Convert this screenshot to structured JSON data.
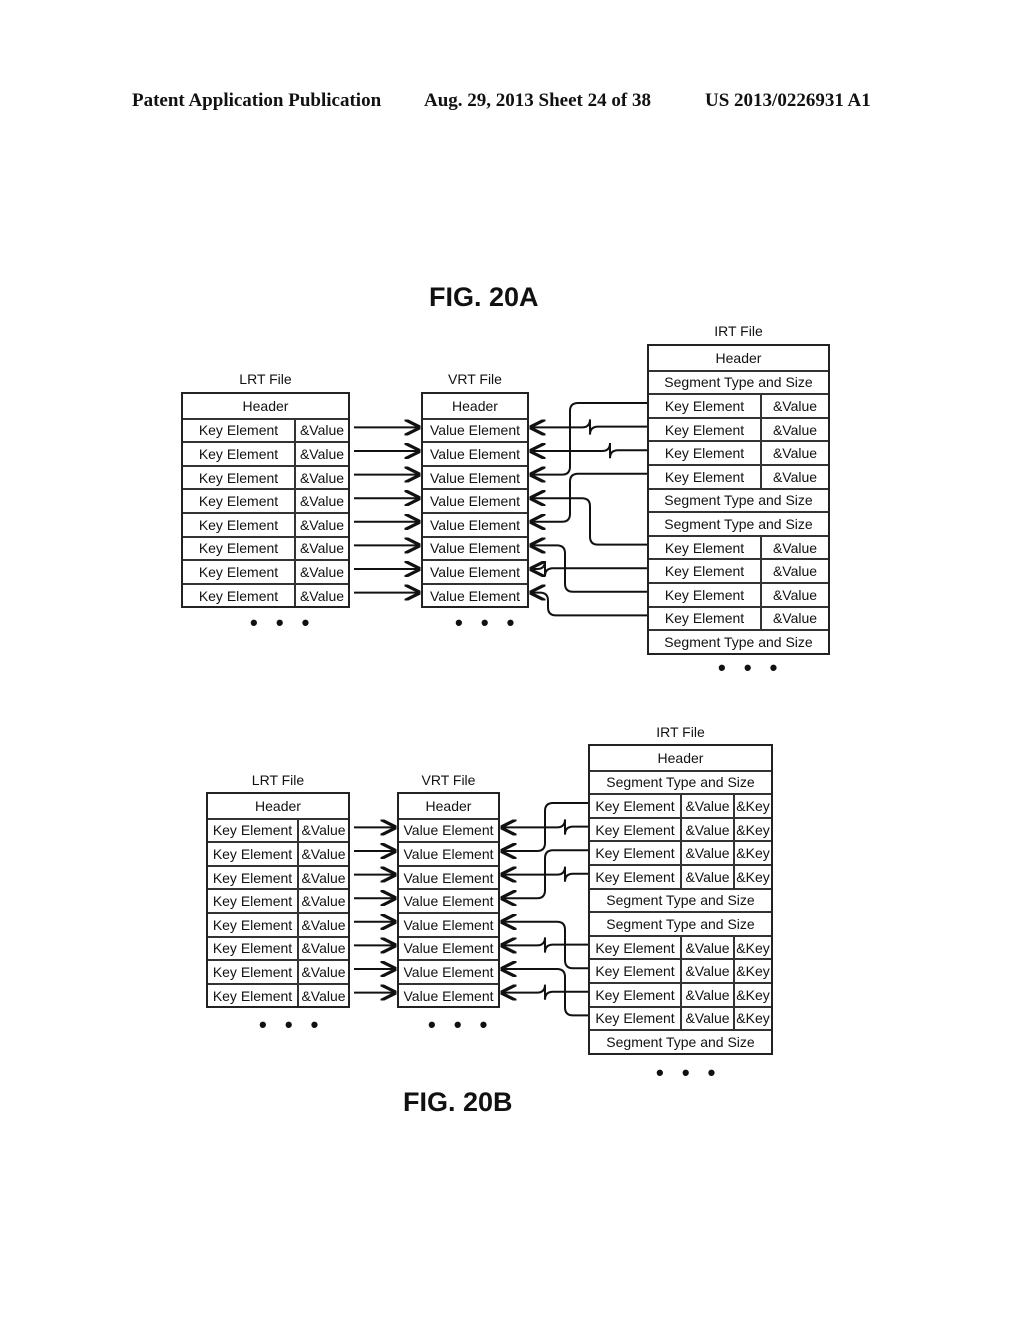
{
  "page_header": {
    "left": "Patent Application Publication",
    "middle": "Aug. 29, 2013  Sheet 24 of 38",
    "right": "US 2013/0226931 A1"
  },
  "fig_a": {
    "title": "FIG. 20A",
    "lrt": {
      "label": "LRT File",
      "header": "Header",
      "rows": [
        [
          "Key Element",
          "&Value"
        ],
        [
          "Key Element",
          "&Value"
        ],
        [
          "Key Element",
          "&Value"
        ],
        [
          "Key Element",
          "&Value"
        ],
        [
          "Key Element",
          "&Value"
        ],
        [
          "Key Element",
          "&Value"
        ],
        [
          "Key Element",
          "&Value"
        ],
        [
          "Key Element",
          "&Value"
        ]
      ],
      "ellipsis": "• • •"
    },
    "vrt": {
      "label": "VRT File",
      "header": "Header",
      "rows": [
        "Value Element",
        "Value Element",
        "Value Element",
        "Value Element",
        "Value Element",
        "Value Element",
        "Value Element",
        "Value Element"
      ],
      "ellipsis": "• • •"
    },
    "irt": {
      "label": "IRT File",
      "rows": [
        {
          "type": "full",
          "text": "Header"
        },
        {
          "type": "full",
          "text": "Segment Type and Size"
        },
        {
          "type": "kv",
          "cells": [
            "Key Element",
            "&Value"
          ]
        },
        {
          "type": "kv",
          "cells": [
            "Key Element",
            "&Value"
          ]
        },
        {
          "type": "kv",
          "cells": [
            "Key Element",
            "&Value"
          ]
        },
        {
          "type": "kv",
          "cells": [
            "Key Element",
            "&Value"
          ]
        },
        {
          "type": "full",
          "text": "Segment Type and Size"
        },
        {
          "type": "full",
          "text": "Segment Type and Size"
        },
        {
          "type": "kv",
          "cells": [
            "Key Element",
            "&Value"
          ]
        },
        {
          "type": "kv",
          "cells": [
            "Key Element",
            "&Value"
          ]
        },
        {
          "type": "kv",
          "cells": [
            "Key Element",
            "&Value"
          ]
        },
        {
          "type": "kv",
          "cells": [
            "Key Element",
            "&Value"
          ]
        },
        {
          "type": "full",
          "text": "Segment Type and Size"
        }
      ],
      "ellipsis": "• • •"
    },
    "irt_to_vrt_links": [
      [
        2,
        2
      ],
      [
        3,
        0
      ],
      [
        4,
        1
      ],
      [
        5,
        4
      ],
      [
        8,
        3
      ],
      [
        9,
        6
      ],
      [
        10,
        5
      ],
      [
        11,
        7
      ]
    ]
  },
  "fig_b": {
    "title": "FIG. 20B",
    "lrt": {
      "label": "LRT File",
      "header": "Header",
      "rows": [
        [
          "Key Element",
          "&Value"
        ],
        [
          "Key Element",
          "&Value"
        ],
        [
          "Key Element",
          "&Value"
        ],
        [
          "Key Element",
          "&Value"
        ],
        [
          "Key Element",
          "&Value"
        ],
        [
          "Key Element",
          "&Value"
        ],
        [
          "Key Element",
          "&Value"
        ],
        [
          "Key Element",
          "&Value"
        ]
      ],
      "ellipsis": "• • •"
    },
    "vrt": {
      "label": "VRT File",
      "header": "Header",
      "rows": [
        "Value Element",
        "Value Element",
        "Value Element",
        "Value Element",
        "Value Element",
        "Value Element",
        "Value Element",
        "Value Element"
      ],
      "ellipsis": "• • •"
    },
    "irt": {
      "label": "IRT File",
      "rows": [
        {
          "type": "full",
          "text": "Header"
        },
        {
          "type": "full",
          "text": "Segment Type and Size"
        },
        {
          "type": "kvk",
          "cells": [
            "Key Element",
            "&Value",
            "&Key"
          ]
        },
        {
          "type": "kvk",
          "cells": [
            "Key Element",
            "&Value",
            "&Key"
          ]
        },
        {
          "type": "kvk",
          "cells": [
            "Key Element",
            "&Value",
            "&Key"
          ]
        },
        {
          "type": "kvk",
          "cells": [
            "Key Element",
            "&Value",
            "&Key"
          ]
        },
        {
          "type": "full",
          "text": "Segment Type and Size"
        },
        {
          "type": "full",
          "text": "Segment Type and Size"
        },
        {
          "type": "kvk",
          "cells": [
            "Key Element",
            "&Value",
            "&Key"
          ]
        },
        {
          "type": "kvk",
          "cells": [
            "Key Element",
            "&Value",
            "&Key"
          ]
        },
        {
          "type": "kvk",
          "cells": [
            "Key Element",
            "&Value",
            "&Key"
          ]
        },
        {
          "type": "kvk",
          "cells": [
            "Key Element",
            "&Value",
            "&Key"
          ]
        },
        {
          "type": "full",
          "text": "Segment Type and Size"
        }
      ],
      "ellipsis": "• • •"
    },
    "irt_to_vrt_links": [
      [
        2,
        1
      ],
      [
        3,
        0
      ],
      [
        4,
        3
      ],
      [
        5,
        2
      ],
      [
        8,
        5
      ],
      [
        9,
        4
      ],
      [
        10,
        7
      ],
      [
        11,
        6
      ]
    ]
  }
}
